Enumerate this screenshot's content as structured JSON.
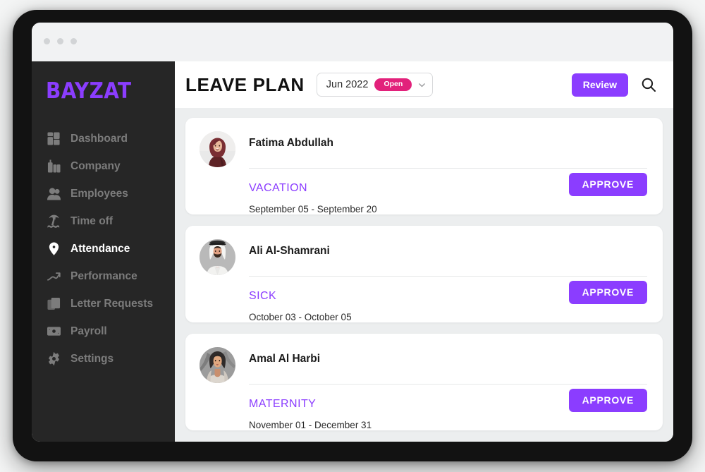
{
  "window": {
    "traffic_lights": [
      "close",
      "minimize",
      "maximize"
    ]
  },
  "sidebar": {
    "logo": "BAYZAT",
    "items": [
      {
        "label": "Dashboard",
        "icon": "dashboard-grid-icon",
        "active": false
      },
      {
        "label": "Company",
        "icon": "buildings-icon",
        "active": false
      },
      {
        "label": "Employees",
        "icon": "people-icon",
        "active": false
      },
      {
        "label": "Time off",
        "icon": "palm-tree-icon",
        "active": false
      },
      {
        "label": "Attendance",
        "icon": "location-pin-icon",
        "active": true
      },
      {
        "label": "Performance",
        "icon": "trending-up-icon",
        "active": false
      },
      {
        "label": "Letter Requests",
        "icon": "documents-icon",
        "active": false
      },
      {
        "label": "Payroll",
        "icon": "banknote-icon",
        "active": false
      },
      {
        "label": "Settings",
        "icon": "gear-icon",
        "active": false
      }
    ]
  },
  "header": {
    "title": "LEAVE PLAN",
    "period": {
      "label": "Jun 2022",
      "badge": "Open",
      "badge_color": "#E2217B",
      "chevron_icon": "chevron-down-icon"
    },
    "review_label": "Review",
    "search_icon": "search-icon"
  },
  "theme": {
    "accent": "#8B3DFF",
    "sidebar_bg": "#262626",
    "page_bg": "#eceeef",
    "badge_pink": "#E2217B"
  },
  "leave_requests": [
    {
      "employee": "Fatima Abdullah",
      "avatar": "avatar-woman-maroon-hijab",
      "type": "VACATION",
      "dates": "September 05 - September 20",
      "action_label": "APPROVE"
    },
    {
      "employee": "Ali Al-Shamrani",
      "avatar": "avatar-man-white-ghutra",
      "type": "SICK",
      "dates": "October 03 - October 05",
      "action_label": "APPROVE"
    },
    {
      "employee": "Amal Al Harbi",
      "avatar": "avatar-woman-grey-scarf",
      "type": "MATERNITY",
      "dates": "November 01 - December 31",
      "action_label": "APPROVE"
    }
  ]
}
